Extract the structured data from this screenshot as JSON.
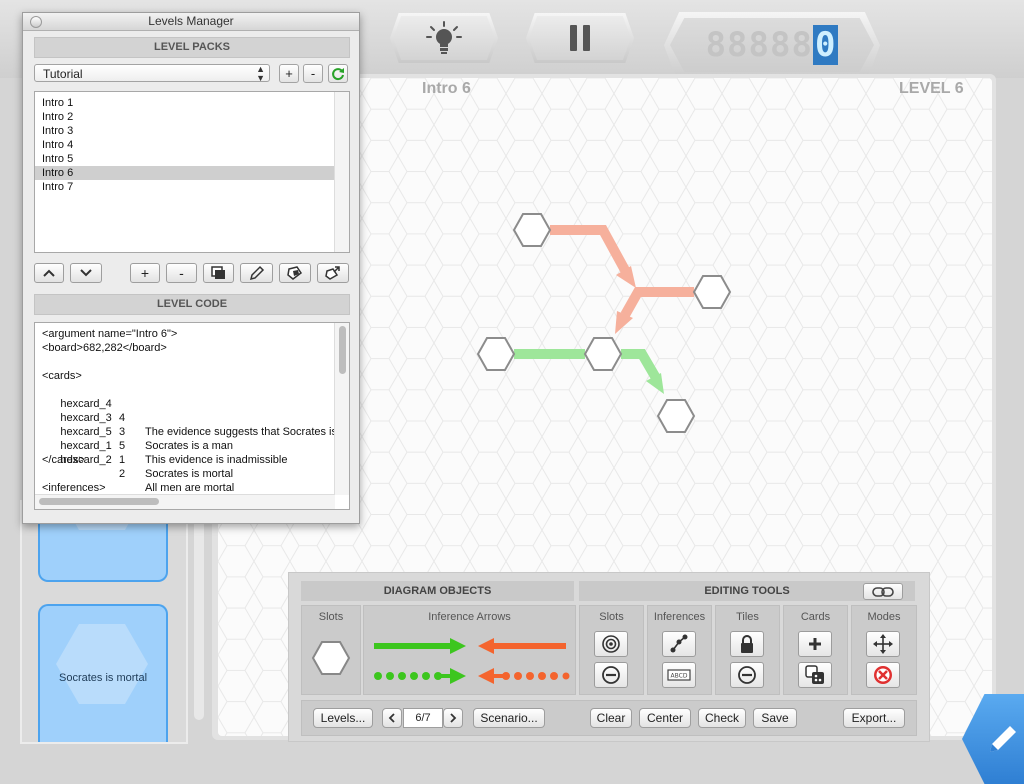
{
  "header": {
    "hint_icon": "lightbulb-icon",
    "pause_icon": "pause-icon",
    "timer_dim": "88888",
    "timer_lit": "0"
  },
  "board": {
    "level_name": "Intro 6",
    "level_number": "LEVEL 6"
  },
  "card_panel": {
    "cards": [
      {
        "label": ""
      },
      {
        "label": "Socrates is mortal"
      }
    ]
  },
  "levels_manager": {
    "title": "Levels Manager",
    "packs_header": "LEVEL PACKS",
    "pack_select": "Tutorial",
    "pack_buttons": {
      "add": "+",
      "remove": "-"
    },
    "levels": [
      "Intro 1",
      "Intro 2",
      "Intro 3",
      "Intro 4",
      "Intro 5",
      "Intro 6",
      "Intro 7"
    ],
    "selected_level": "Intro 6",
    "list_buttons": {
      "add": "+",
      "remove": "-"
    },
    "code_header": "LEVEL CODE",
    "code": {
      "line1": "<argument name=\"Intro 6\">",
      "line2": "<board>682,282</board>",
      "line3": "<cards>",
      "cards": [
        {
          "id": "hexcard_4",
          "n": "4",
          "text": "The evidence suggests that Socrates is"
        },
        {
          "id": "hexcard_3",
          "n": "3",
          "text": "Socrates is a man"
        },
        {
          "id": "hexcard_5",
          "n": "5",
          "text": "This evidence is inadmissible"
        },
        {
          "id": "hexcard_1",
          "n": "1",
          "text": "Socrates is mortal"
        },
        {
          "id": "hexcard_2",
          "n": "2",
          "text": "All men are mortal"
        }
      ],
      "line_end_cards": "</cards>",
      "line_inferences": "<inferences>"
    }
  },
  "tool_panel": {
    "diagram_objects_header": "DIAGRAM OBJECTS",
    "editing_tools_header": "EDITING TOOLS",
    "groups": {
      "slots": "Slots",
      "inference_arrows": "Inference Arrows",
      "edit_slots": "Slots",
      "inferences": "Inferences",
      "tiles": "Tiles",
      "cards": "Cards",
      "modes": "Modes"
    },
    "footer": {
      "levels": "Levels...",
      "page": "6/7",
      "scenario": "Scenario...",
      "clear": "Clear",
      "center": "Center",
      "check": "Check",
      "save": "Save",
      "export": "Export..."
    },
    "arrow_colors": {
      "support": "#3cc61e",
      "attack": "#f4642e"
    }
  },
  "colors": {
    "diagram_red": "#f6b09c",
    "diagram_green": "#9ee69a",
    "card_blue": "#9fd0fb",
    "edit_blue": "#2f7fd3"
  }
}
